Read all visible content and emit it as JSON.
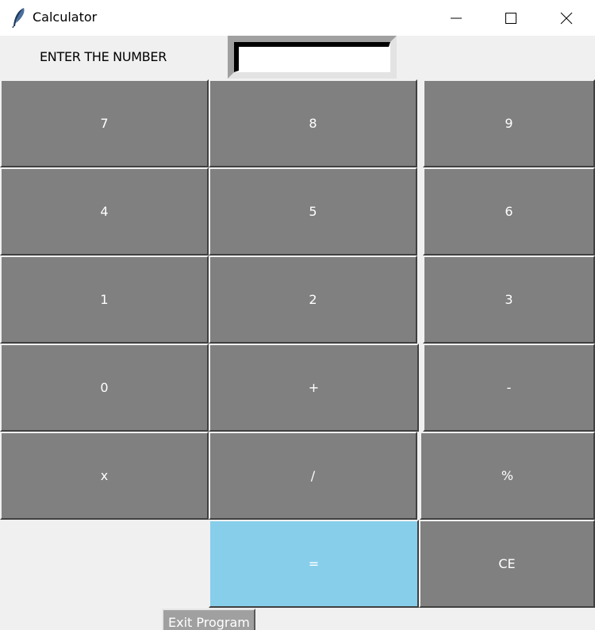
{
  "window": {
    "title": "Calculator",
    "icon": "feather-icon",
    "controls": {
      "minimize": "minimize-icon",
      "maximize": "maximize-icon",
      "close": "close-icon"
    }
  },
  "entry": {
    "label": "ENTER THE NUMBER",
    "value": ""
  },
  "keypad": {
    "row1": [
      "7",
      "8",
      "9"
    ],
    "row2": [
      "4",
      "5",
      "6"
    ],
    "row3": [
      "1",
      "2",
      "3"
    ],
    "row4": [
      "0",
      "+",
      "-"
    ],
    "row5": [
      "x",
      "/",
      "%"
    ],
    "row6": [
      "=",
      "CE"
    ]
  },
  "exit_label": "Exit Program",
  "colors": {
    "button": "#808080",
    "equals_button": "#87ceeb",
    "background": "#f0f0f0",
    "button_text": "#ffffff"
  }
}
